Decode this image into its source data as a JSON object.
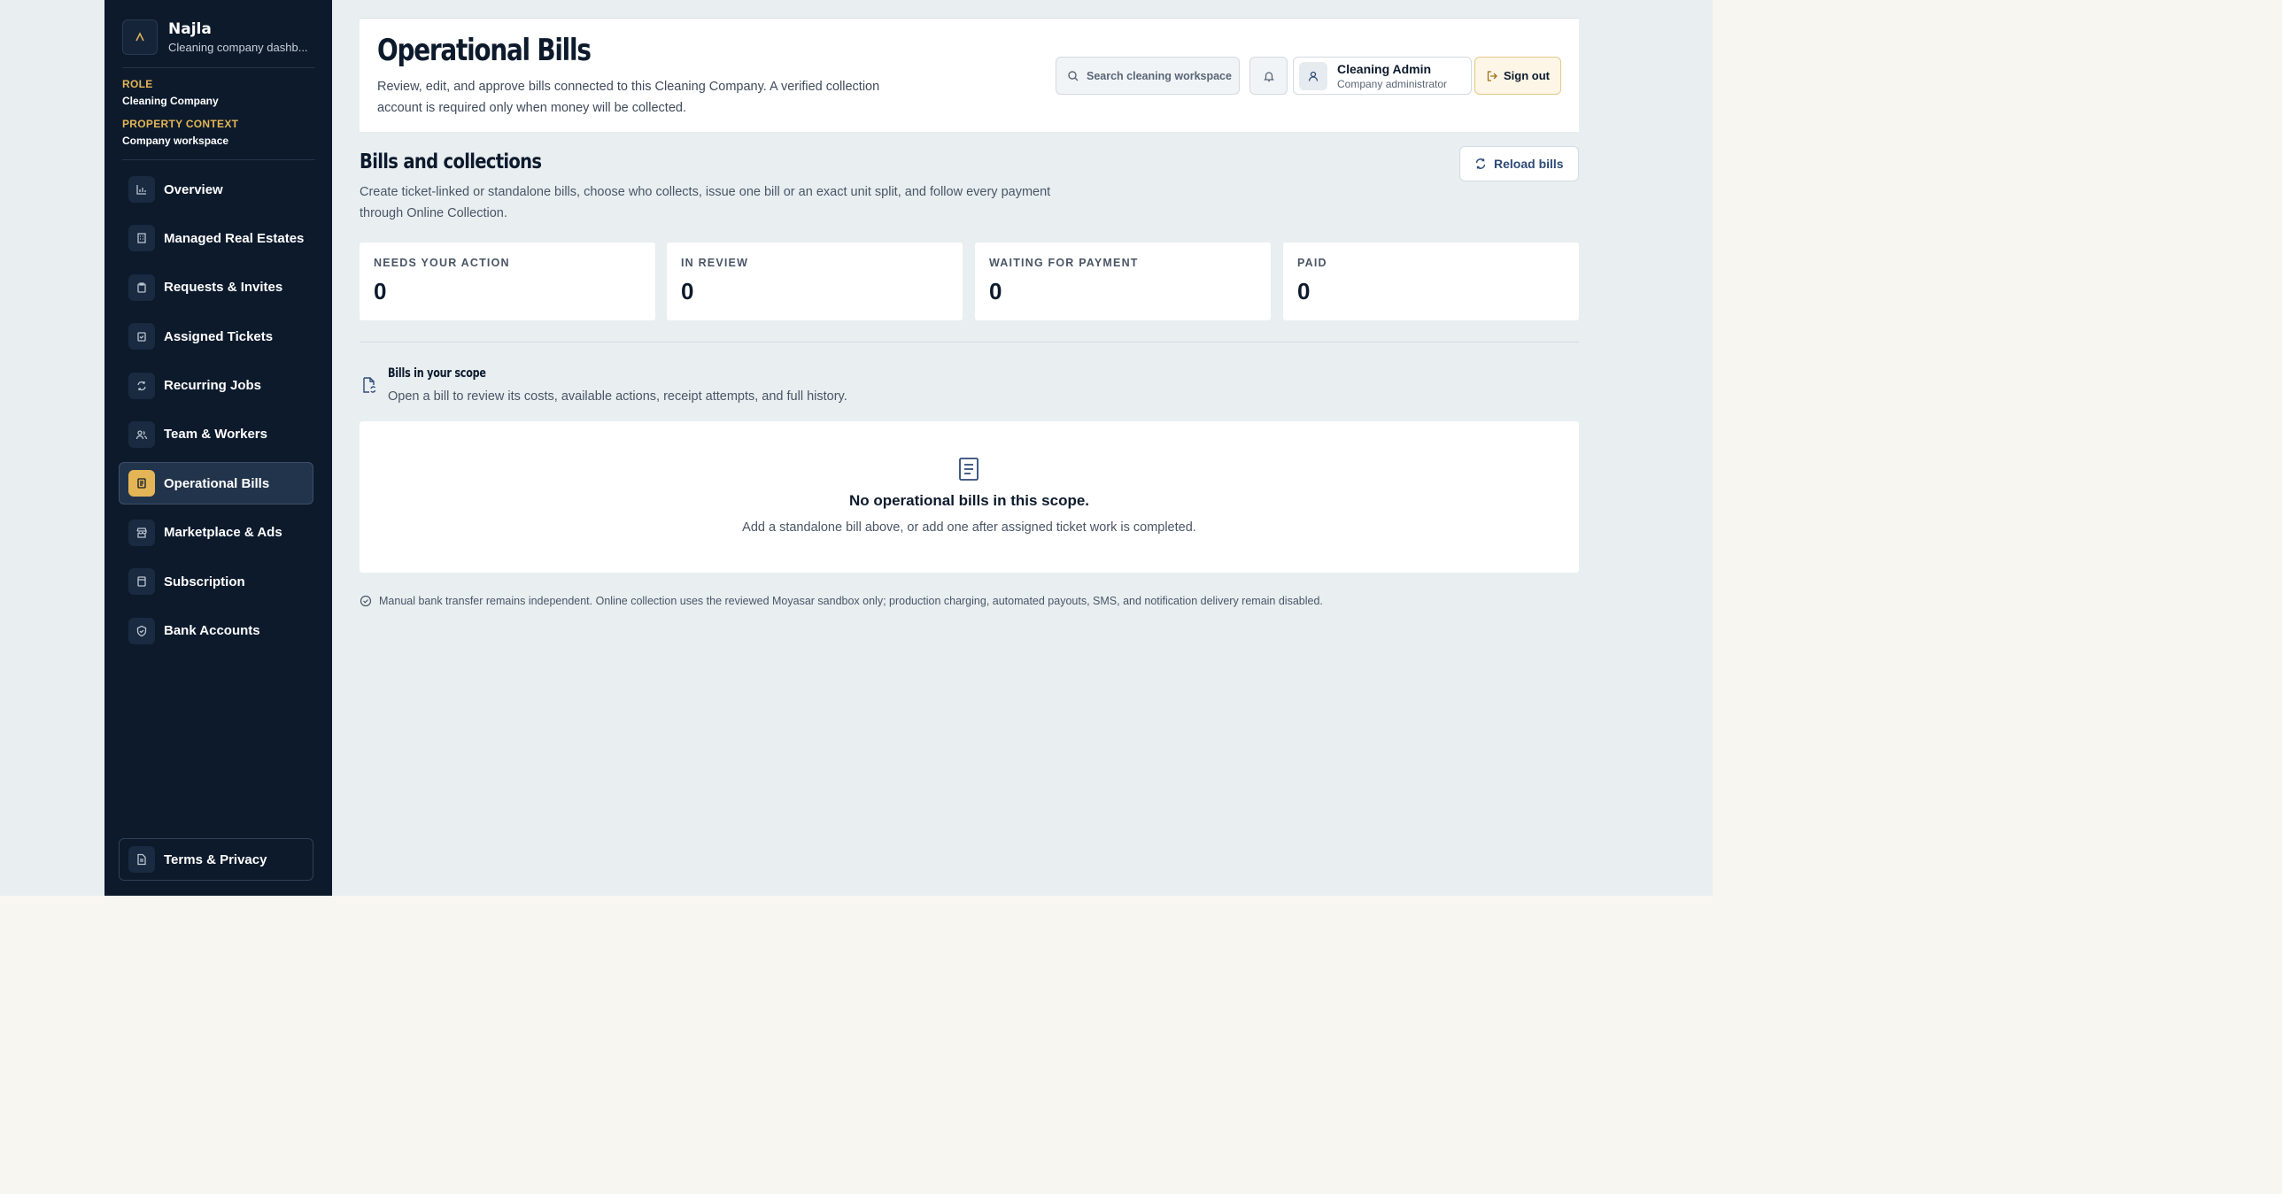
{
  "sidebar": {
    "brand_name": "Najla",
    "brand_sub": "Cleaning company dashb...",
    "role_label": "ROLE",
    "role_value": "Cleaning Company",
    "context_label": "PROPERTY CONTEXT",
    "context_value": "Company workspace",
    "items": [
      {
        "label": "Overview",
        "icon": "chart-icon"
      },
      {
        "label": "Managed Real Estates",
        "icon": "building-icon"
      },
      {
        "label": "Requests & Invites",
        "icon": "clipboard-icon"
      },
      {
        "label": "Assigned Tickets",
        "icon": "clipboard-check-icon"
      },
      {
        "label": "Recurring Jobs",
        "icon": "repeat-icon"
      },
      {
        "label": "Team & Workers",
        "icon": "users-icon"
      },
      {
        "label": "Operational Bills",
        "icon": "receipt-icon",
        "active": true
      },
      {
        "label": "Marketplace & Ads",
        "icon": "store-icon"
      },
      {
        "label": "Subscription",
        "icon": "card-icon"
      },
      {
        "label": "Bank Accounts",
        "icon": "shield-icon"
      }
    ],
    "terms_label": "Terms & Privacy"
  },
  "header": {
    "title": "Operational Bills",
    "description": "Review, edit, and approve bills connected to this Cleaning Company. A verified collection account is required only when money will be collected.",
    "search_placeholder": "Search cleaning workspace",
    "user_name": "Cleaning Admin",
    "user_role": "Company administrator",
    "signout_label": "Sign out"
  },
  "section": {
    "title": "Bills and collections",
    "description": "Create ticket-linked or standalone bills, choose who collects, issue one bill or an exact unit split, and follow every payment through Online Collection.",
    "reload_label": "Reload bills"
  },
  "stats": [
    {
      "label": "NEEDS YOUR ACTION",
      "value": "0"
    },
    {
      "label": "IN REVIEW",
      "value": "0"
    },
    {
      "label": "WAITING FOR PAYMENT",
      "value": "0"
    },
    {
      "label": "PAID",
      "value": "0"
    }
  ],
  "scope": {
    "title": "Bills in your scope",
    "description": "Open a bill to review its costs, available actions, receipt attempts, and full history."
  },
  "empty": {
    "title": "No operational bills in this scope.",
    "description": "Add a standalone bill above, or add one after assigned ticket work is completed."
  },
  "footnote": "Manual bank transfer remains independent. Online collection uses the reviewed Moyasar sandbox only; production charging, automated payouts, SMS, and notification delivery remain disabled.",
  "colors": {
    "sidebar_bg": "#0c1a2c",
    "accent": "#e3b556",
    "link": "#2e4a78"
  }
}
